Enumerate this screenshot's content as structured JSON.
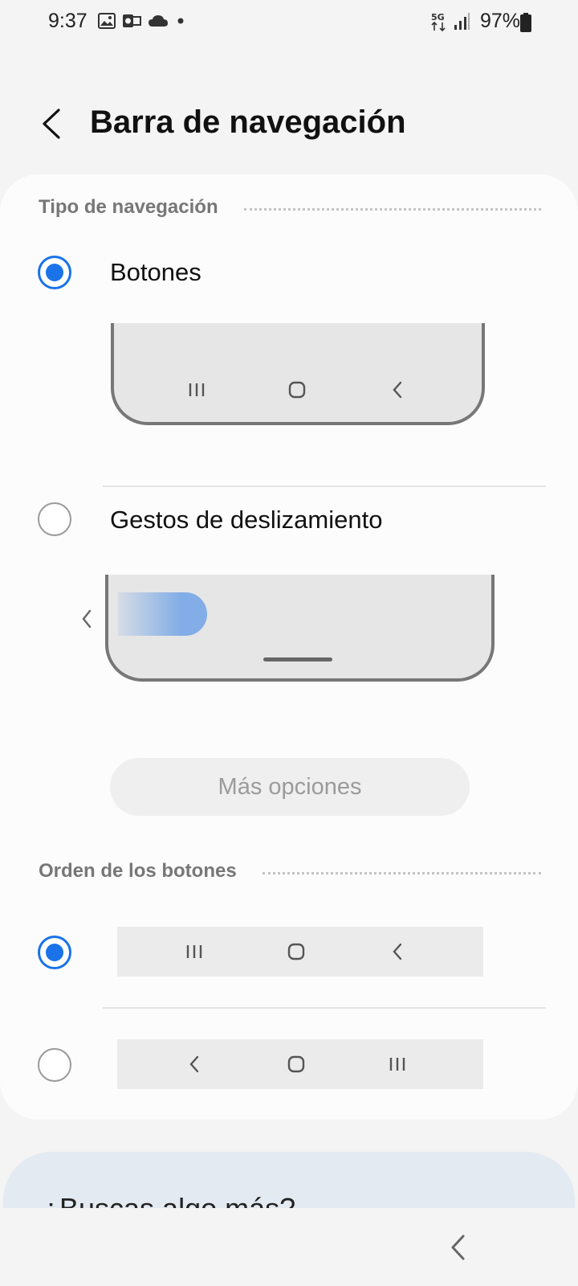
{
  "status_bar": {
    "time": "9:37",
    "battery_percent": "97%",
    "network": "5G",
    "left_icons": [
      "image-icon",
      "outlook-icon",
      "cloud-icon",
      "dot-icon"
    ],
    "right_icons": [
      "5g-icon",
      "signal-icon",
      "battery-icon"
    ]
  },
  "header": {
    "title": "Barra de navegación",
    "back_icon": "back-arrow-icon"
  },
  "navigation_type": {
    "section_label": "Tipo de navegación",
    "options": [
      {
        "label": "Botones",
        "selected": true
      },
      {
        "label": "Gestos de deslizamiento",
        "selected": false
      }
    ],
    "buttons_preview_icons": [
      "recents-icon",
      "home-icon",
      "back-icon"
    ],
    "more_options_label": "Más opciones"
  },
  "button_order": {
    "section_label": "Orden de los botones",
    "options": [
      {
        "selected": true,
        "icons": [
          "recents-icon",
          "home-icon",
          "back-icon"
        ]
      },
      {
        "selected": false,
        "icons": [
          "back-icon",
          "home-icon",
          "recents-icon"
        ]
      }
    ]
  },
  "search": {
    "title": "¿Buscas algo más?"
  },
  "colors": {
    "accent": "#1a73e8",
    "background": "#f4f4f4",
    "card": "#fcfcfc"
  }
}
